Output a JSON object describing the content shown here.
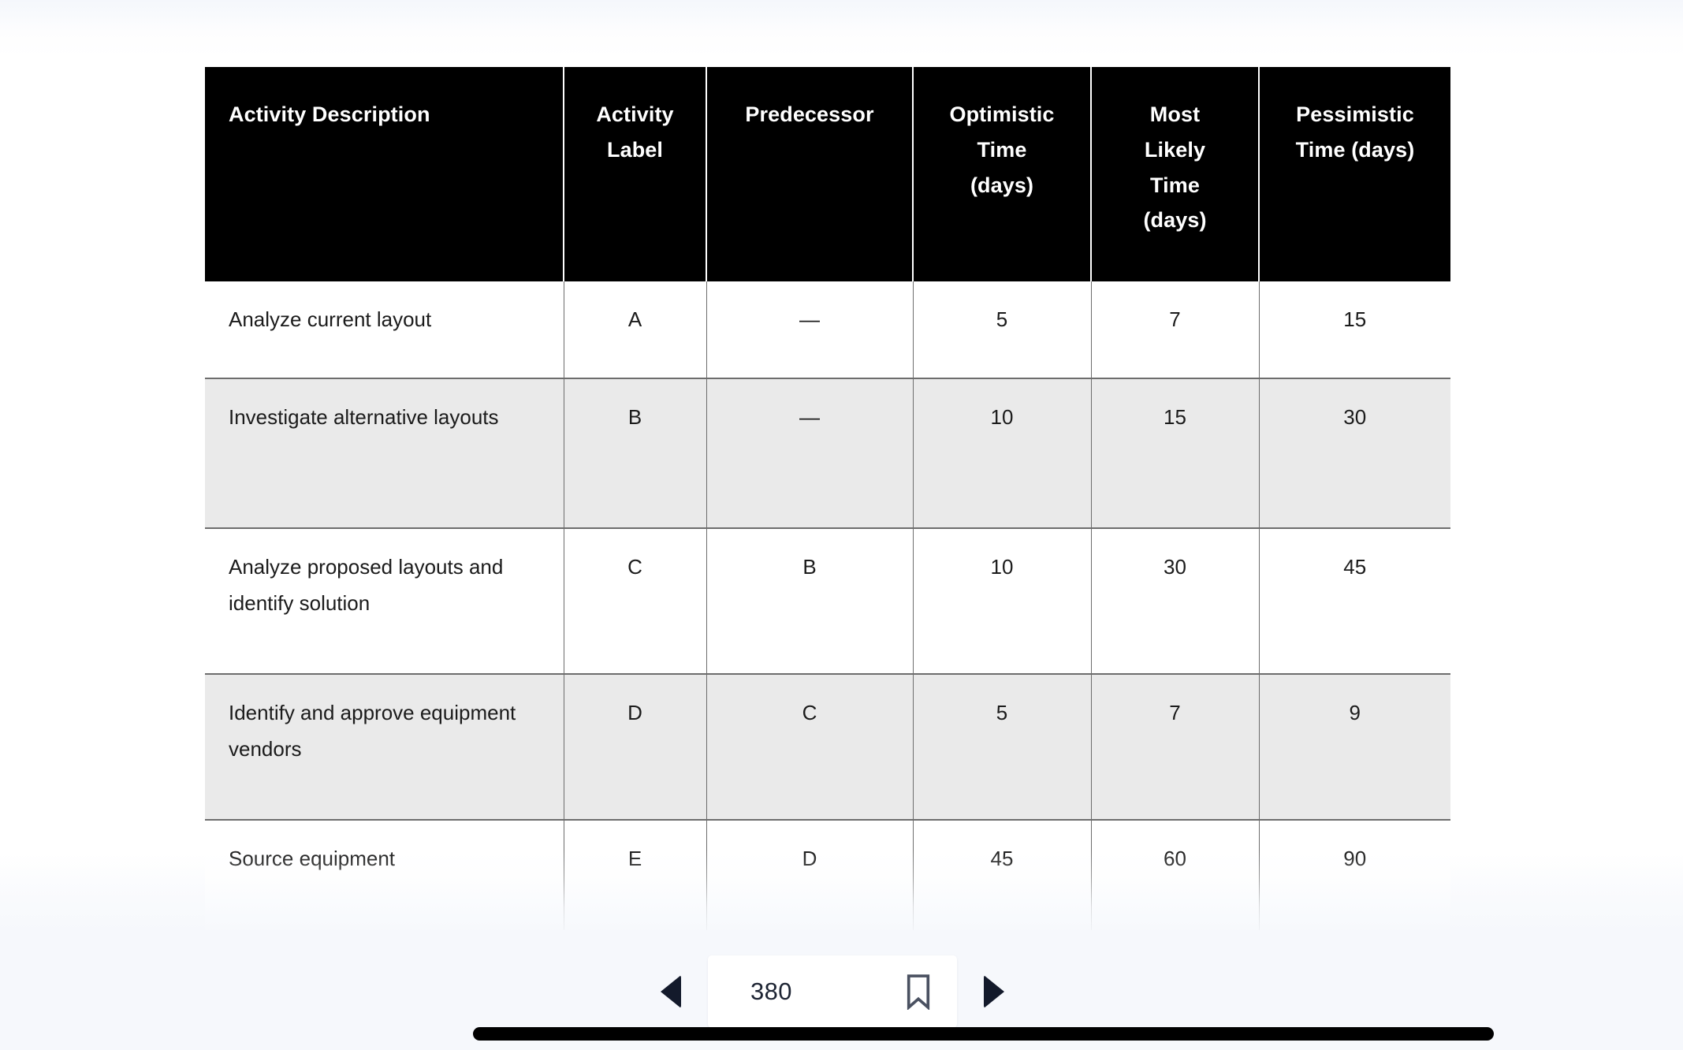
{
  "document": {
    "table": {
      "columns": [
        {
          "key": "description",
          "label": "Activity Description",
          "align": "left"
        },
        {
          "key": "label",
          "label": "Activity\nLabel",
          "align": "center"
        },
        {
          "key": "predecessor",
          "label": "Predecessor",
          "align": "center"
        },
        {
          "key": "optimistic",
          "label": "Optimistic\nTime\n(days)",
          "align": "center"
        },
        {
          "key": "most_likely",
          "label": "Most\nLikely\nTime\n(days)",
          "align": "center"
        },
        {
          "key": "pessimistic",
          "label": "Pessimistic\nTime (days)",
          "align": "center"
        }
      ],
      "header": {
        "col1": "Activity Description",
        "col2_line1": "Activity",
        "col2_line2": "Label",
        "col3": "Predecessor",
        "col4_line1": "Optimistic",
        "col4_line2": "Time",
        "col4_line3": "(days)",
        "col5_line1": "Most",
        "col5_line2": "Likely",
        "col5_line3": "Time",
        "col5_line4": "(days)",
        "col6_line1": "Pessimistic",
        "col6_line2": "Time (days)"
      },
      "rows": [
        {
          "description": "Analyze current layout",
          "label": "A",
          "predecessor": "—",
          "optimistic": "5",
          "most_likely": "7",
          "pessimistic": "15"
        },
        {
          "description": "Investigate alternative layouts",
          "label": "B",
          "predecessor": "—",
          "optimistic": "10",
          "most_likely": "15",
          "pessimistic": "30"
        },
        {
          "description": "Analyze proposed layouts and identify solution",
          "label": "C",
          "predecessor": "B",
          "optimistic": "10",
          "most_likely": "30",
          "pessimistic": "45"
        },
        {
          "description": "Identify and approve equipment vendors",
          "label": "D",
          "predecessor": "C",
          "optimistic": "5",
          "most_likely": "7",
          "pessimistic": "9"
        },
        {
          "description": "Source equipment",
          "label": "E",
          "predecessor": "D",
          "optimistic": "45",
          "most_likely": "60",
          "pessimistic": "90"
        }
      ]
    }
  },
  "bottom_nav": {
    "previous_page_icon": "triangle-left-icon",
    "next_page_icon": "triangle-right-icon",
    "page_number": "380",
    "bookmark_icon": "bookmark-icon"
  },
  "colors": {
    "header_background": "#000000",
    "header_text": "#ffffff",
    "row_shaded": "#eaeaea",
    "row_plain": "#ffffff",
    "cell_border": "#6d6d6d",
    "body_text": "#1b1b1b",
    "nav_accent": "#131a2b",
    "page_background": "#f6f8fc"
  }
}
